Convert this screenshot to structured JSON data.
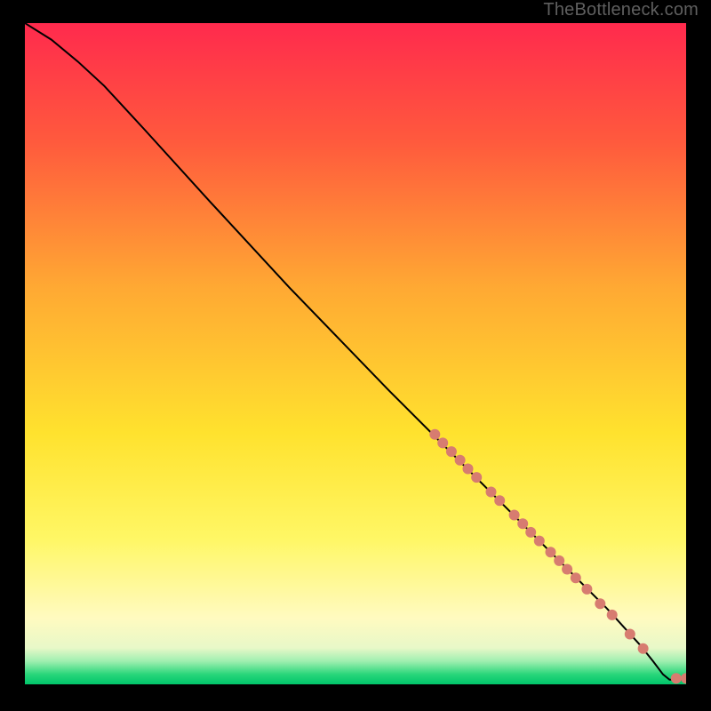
{
  "watermark": "TheBottleneck.com",
  "chart_data": {
    "type": "line",
    "title": "",
    "xlabel": "",
    "ylabel": "",
    "xlim": [
      0,
      100
    ],
    "ylim": [
      0,
      100
    ],
    "gradient_stops": [
      {
        "offset": 0,
        "color": "#ff2a4d"
      },
      {
        "offset": 0.18,
        "color": "#ff5a3d"
      },
      {
        "offset": 0.4,
        "color": "#ffa933"
      },
      {
        "offset": 0.62,
        "color": "#ffe22e"
      },
      {
        "offset": 0.78,
        "color": "#fff765"
      },
      {
        "offset": 0.9,
        "color": "#fffac0"
      },
      {
        "offset": 0.945,
        "color": "#e8f8c8"
      },
      {
        "offset": 0.965,
        "color": "#9fefb0"
      },
      {
        "offset": 0.985,
        "color": "#28d67a"
      },
      {
        "offset": 1.0,
        "color": "#00c56a"
      }
    ],
    "series": [
      {
        "name": "curve",
        "type": "line",
        "color": "#000000",
        "points": [
          {
            "x": 0,
            "y": 100
          },
          {
            "x": 4,
            "y": 97.5
          },
          {
            "x": 8,
            "y": 94.2
          },
          {
            "x": 12,
            "y": 90.5
          },
          {
            "x": 18,
            "y": 84.0
          },
          {
            "x": 28,
            "y": 73.0
          },
          {
            "x": 40,
            "y": 60.0
          },
          {
            "x": 55,
            "y": 44.5
          },
          {
            "x": 68,
            "y": 31.5
          },
          {
            "x": 80,
            "y": 19.5
          },
          {
            "x": 88,
            "y": 11.5
          },
          {
            "x": 93,
            "y": 6.0
          },
          {
            "x": 95,
            "y": 3.5
          },
          {
            "x": 96.5,
            "y": 1.5
          },
          {
            "x": 97.5,
            "y": 0.7
          },
          {
            "x": 100,
            "y": 0.7
          }
        ]
      },
      {
        "name": "markers",
        "type": "scatter",
        "color": "#d77c70",
        "radius": 6,
        "points": [
          {
            "x": 62.0,
            "y": 37.8
          },
          {
            "x": 63.2,
            "y": 36.5
          },
          {
            "x": 64.5,
            "y": 35.2
          },
          {
            "x": 65.8,
            "y": 33.9
          },
          {
            "x": 67.0,
            "y": 32.6
          },
          {
            "x": 68.3,
            "y": 31.3
          },
          {
            "x": 70.5,
            "y": 29.1
          },
          {
            "x": 71.8,
            "y": 27.8
          },
          {
            "x": 74.0,
            "y": 25.6
          },
          {
            "x": 75.3,
            "y": 24.3
          },
          {
            "x": 76.5,
            "y": 23.0
          },
          {
            "x": 77.8,
            "y": 21.7
          },
          {
            "x": 79.5,
            "y": 20.0
          },
          {
            "x": 80.8,
            "y": 18.7
          },
          {
            "x": 82.0,
            "y": 17.4
          },
          {
            "x": 83.3,
            "y": 16.1
          },
          {
            "x": 85.0,
            "y": 14.4
          },
          {
            "x": 87.0,
            "y": 12.2
          },
          {
            "x": 88.8,
            "y": 10.5
          },
          {
            "x": 91.5,
            "y": 7.6
          },
          {
            "x": 93.5,
            "y": 5.4
          },
          {
            "x": 98.5,
            "y": 0.9
          },
          {
            "x": 100.0,
            "y": 0.9
          }
        ]
      }
    ]
  }
}
